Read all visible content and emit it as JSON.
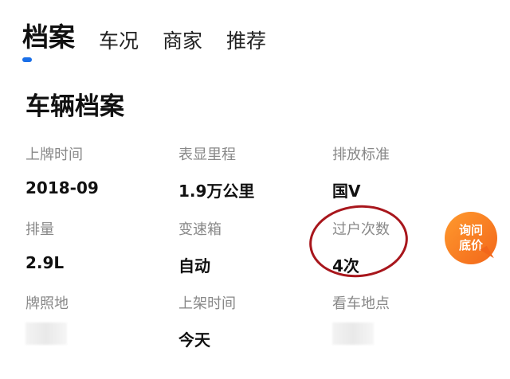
{
  "tabs": [
    {
      "label": "档案",
      "active": true
    },
    {
      "label": "车况"
    },
    {
      "label": "商家"
    },
    {
      "label": "推荐"
    }
  ],
  "section_title": "车辆档案",
  "fields": [
    {
      "label": "上牌时间",
      "value": "2018-09"
    },
    {
      "label": "表显里程",
      "value": "1.9万公里"
    },
    {
      "label": "排放标准",
      "value": "国V"
    },
    {
      "label": "排量",
      "value": "2.9L"
    },
    {
      "label": "变速箱",
      "value": "自动"
    },
    {
      "label": "过户次数",
      "value": "4次"
    },
    {
      "label": "牌照地",
      "value": null,
      "blurred": true
    },
    {
      "label": "上架时间",
      "value": "今天"
    },
    {
      "label": "看车地点",
      "value": null,
      "blurred": true
    }
  ],
  "ask_button": {
    "line1": "询问",
    "line2": "底价"
  },
  "colors": {
    "accent": "#1a6fe8",
    "annotation_circle": "#a8161c",
    "ask_button": "#f57a22"
  }
}
